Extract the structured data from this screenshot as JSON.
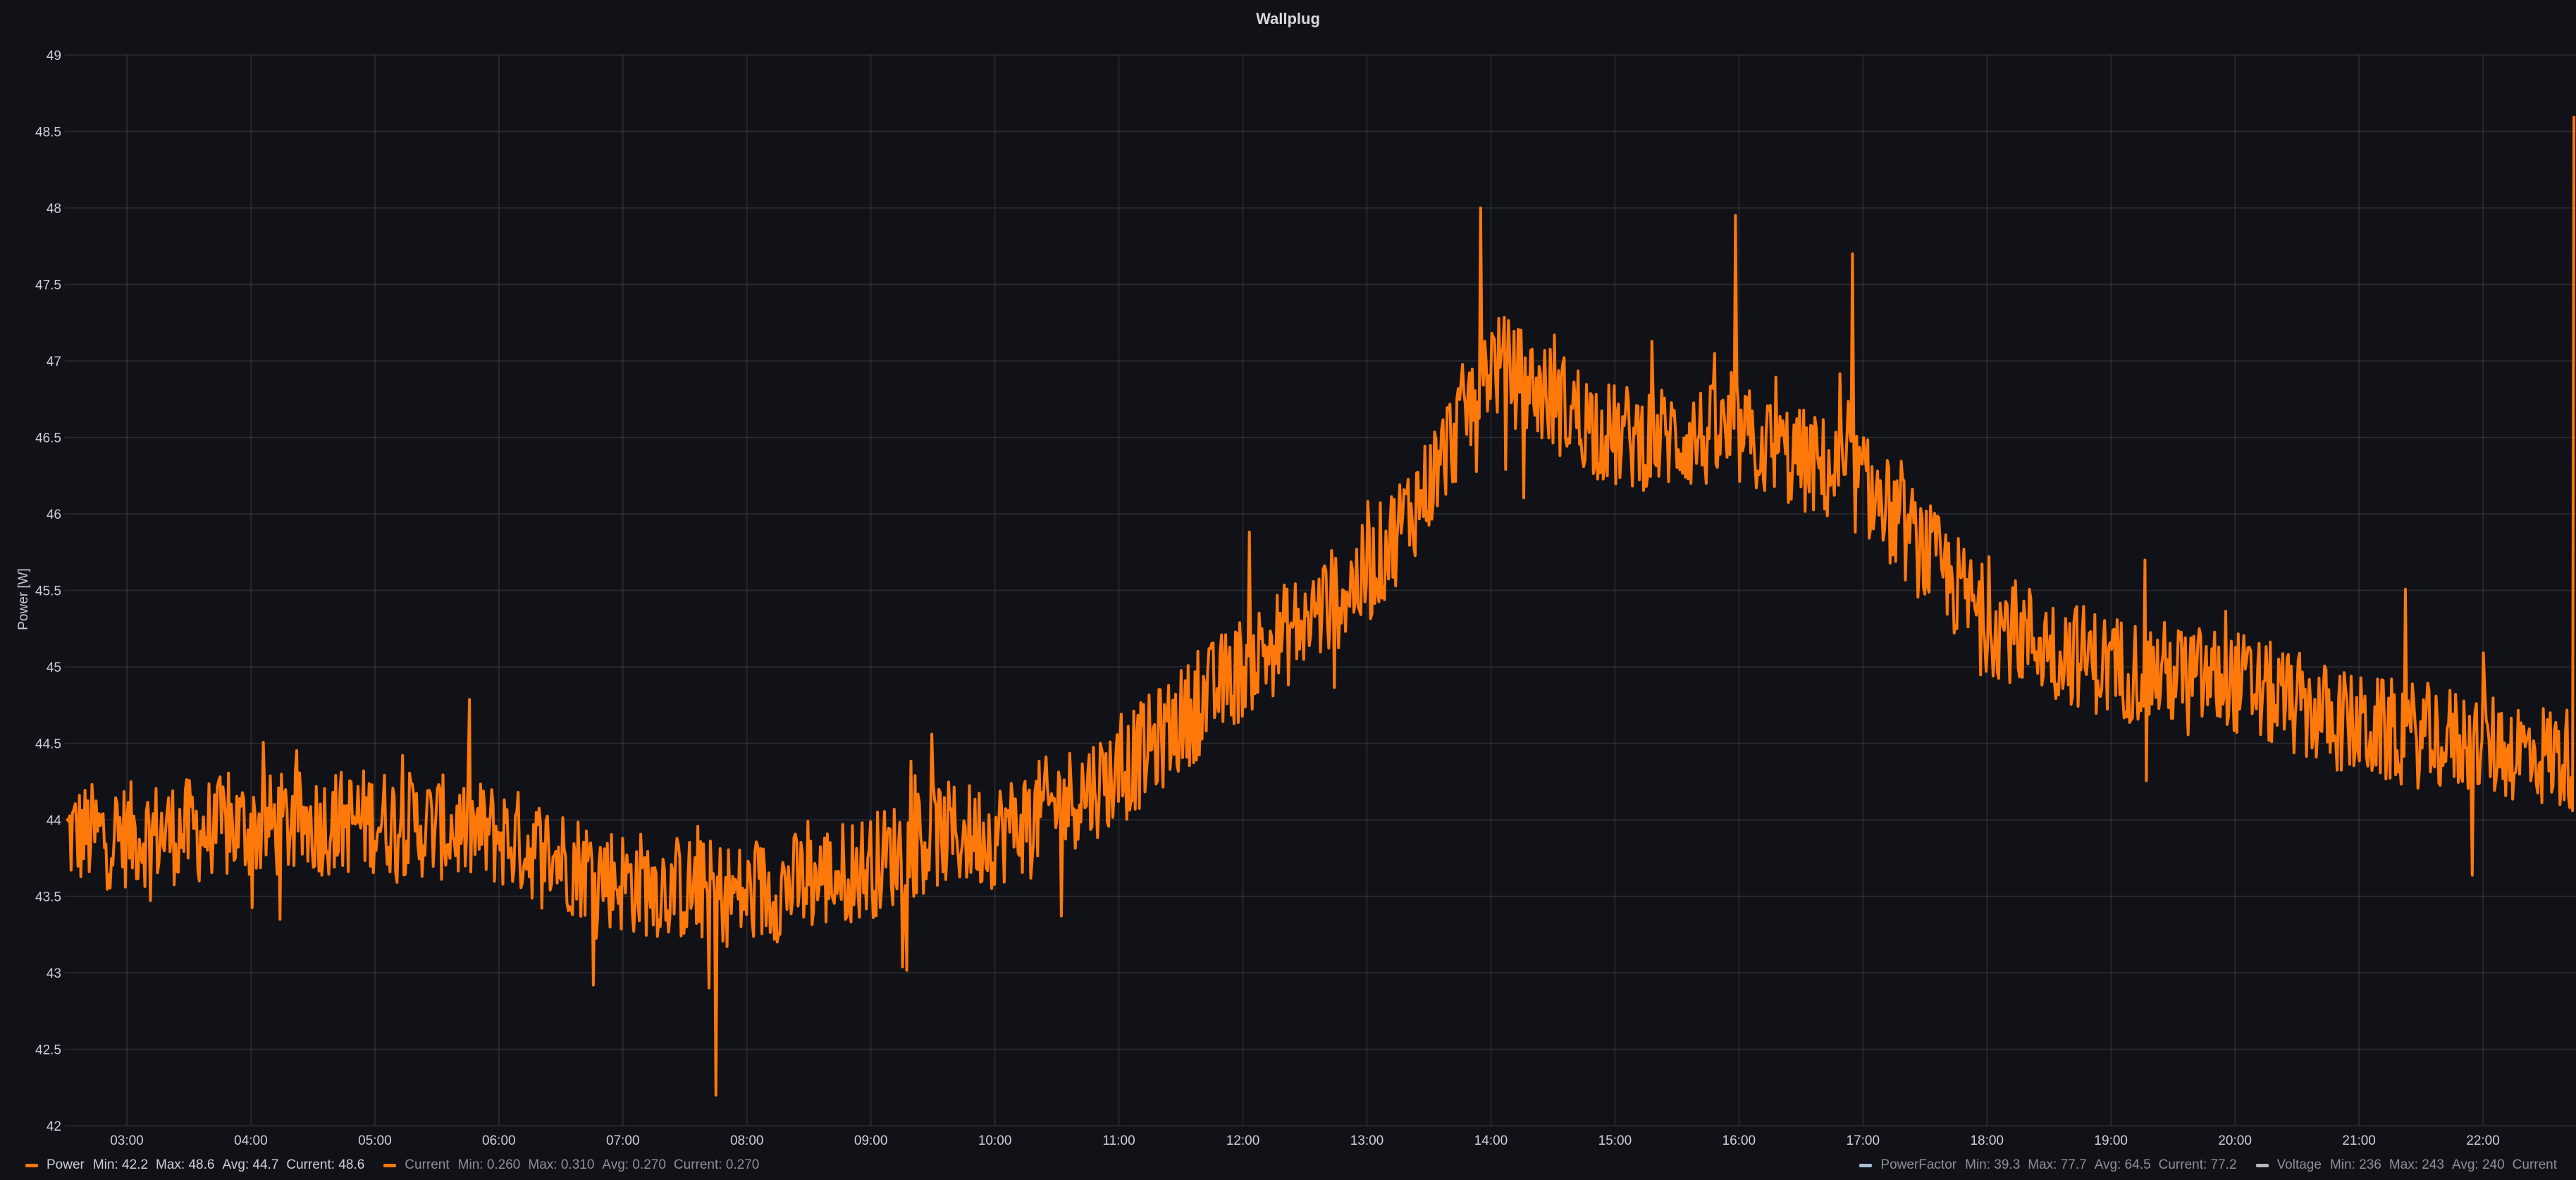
{
  "chart_data": {
    "type": "line",
    "title": "Wallplug",
    "ylabel": "Power [W]",
    "xlabel": "",
    "ylim": [
      42,
      49
    ],
    "y_ticks": [
      "42",
      "42.5",
      "43",
      "43.5",
      "44",
      "44.5",
      "45",
      "45.5",
      "46",
      "46.5",
      "47",
      "47.5",
      "48",
      "48.5",
      "49"
    ],
    "xlim": [
      "02:30",
      "22:45"
    ],
    "x_ticks": [
      "03:00",
      "04:00",
      "05:00",
      "06:00",
      "07:00",
      "08:00",
      "09:00",
      "10:00",
      "11:00",
      "12:00",
      "13:00",
      "14:00",
      "15:00",
      "16:00",
      "17:00",
      "18:00",
      "19:00",
      "20:00",
      "21:00",
      "22:00"
    ],
    "grid": true,
    "legend_position": "bottom",
    "series": [
      {
        "name": "Power",
        "color": "#ff780a",
        "visible": true,
        "stats": {
          "min": "Min: 42.2",
          "max": "Max: 48.6",
          "avg": "Avg: 44.7",
          "current": "Current: 48.6"
        },
        "trend": {
          "x": [
            "02:30",
            "03:00",
            "04:00",
            "05:00",
            "06:00",
            "07:00",
            "08:00",
            "09:00",
            "09:30",
            "10:00",
            "11:00",
            "12:00",
            "13:00",
            "13:30",
            "14:00",
            "15:00",
            "16:00",
            "17:00",
            "18:00",
            "19:00",
            "20:00",
            "21:00",
            "22:00",
            "22:40"
          ],
          "y": [
            43.9,
            43.9,
            43.95,
            44.0,
            43.9,
            43.6,
            43.5,
            43.7,
            43.9,
            43.9,
            44.3,
            45.0,
            45.6,
            46.2,
            47.0,
            46.5,
            46.5,
            46.2,
            45.3,
            45.0,
            44.9,
            44.6,
            44.5,
            44.4
          ]
        },
        "noise_amplitude": 0.35,
        "notable_points": [
          {
            "x": "07:45",
            "y": 42.2
          },
          {
            "x": "13:55",
            "y": 48.0
          },
          {
            "x": "15:58",
            "y": 47.95
          },
          {
            "x": "16:55",
            "y": 47.7
          },
          {
            "x": "22:44",
            "y": 48.6
          }
        ]
      },
      {
        "name": "Current",
        "color": "#ff780a",
        "visible": false,
        "stats": {
          "min": "Min: 0.260",
          "max": "Max: 0.310",
          "avg": "Avg: 0.270",
          "current": "Current: 0.270"
        }
      },
      {
        "name": "PowerFactor",
        "color": "#a4bfd6",
        "visible": false,
        "stats": {
          "min": "Min: 39.3",
          "max": "Max: 77.7",
          "avg": "Avg: 64.5",
          "current": "Current: 77.2"
        }
      },
      {
        "name": "Voltage",
        "color": "#b8b8bf",
        "visible": false,
        "stats": {
          "min": "Min: 236",
          "max": "Max: 243",
          "avg": "Avg: 240",
          "current": "Current"
        }
      }
    ]
  }
}
